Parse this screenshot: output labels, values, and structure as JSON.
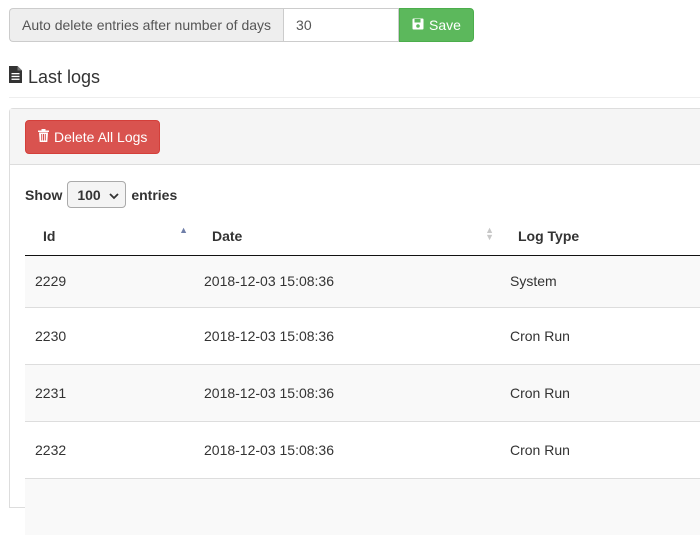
{
  "settings": {
    "auto_delete_label": "Auto delete entries after number of days",
    "days_value": "30",
    "save_label": "Save"
  },
  "section": {
    "title": "Last logs"
  },
  "panel": {
    "delete_all_label": "Delete All Logs"
  },
  "length_menu": {
    "show_label": "Show",
    "selected": "100",
    "entries_label": "entries"
  },
  "table": {
    "headers": [
      "Id",
      "Date",
      "Log Type"
    ],
    "sort": {
      "column": "Id",
      "direction": "ascending"
    },
    "rows": [
      {
        "id": "2229",
        "date": "2018-12-03 15:08:36",
        "type": "System"
      },
      {
        "id": "2230",
        "date": "2018-12-03 15:08:36",
        "type": "Cron Run"
      },
      {
        "id": "2231",
        "date": "2018-12-03 15:08:36",
        "type": "Cron Run"
      },
      {
        "id": "2232",
        "date": "2018-12-03 15:08:36",
        "type": "Cron Run"
      },
      {
        "id": "",
        "date": "",
        "type": ""
      }
    ]
  },
  "colors": {
    "save_green": "#5cb85c",
    "delete_red": "#d9534f",
    "sort_active": "#6f7ea8"
  },
  "icons": {
    "save": "floppy-disk-icon",
    "section": "file-text-icon",
    "delete": "trash-icon",
    "select": "chevron-down-icon"
  }
}
